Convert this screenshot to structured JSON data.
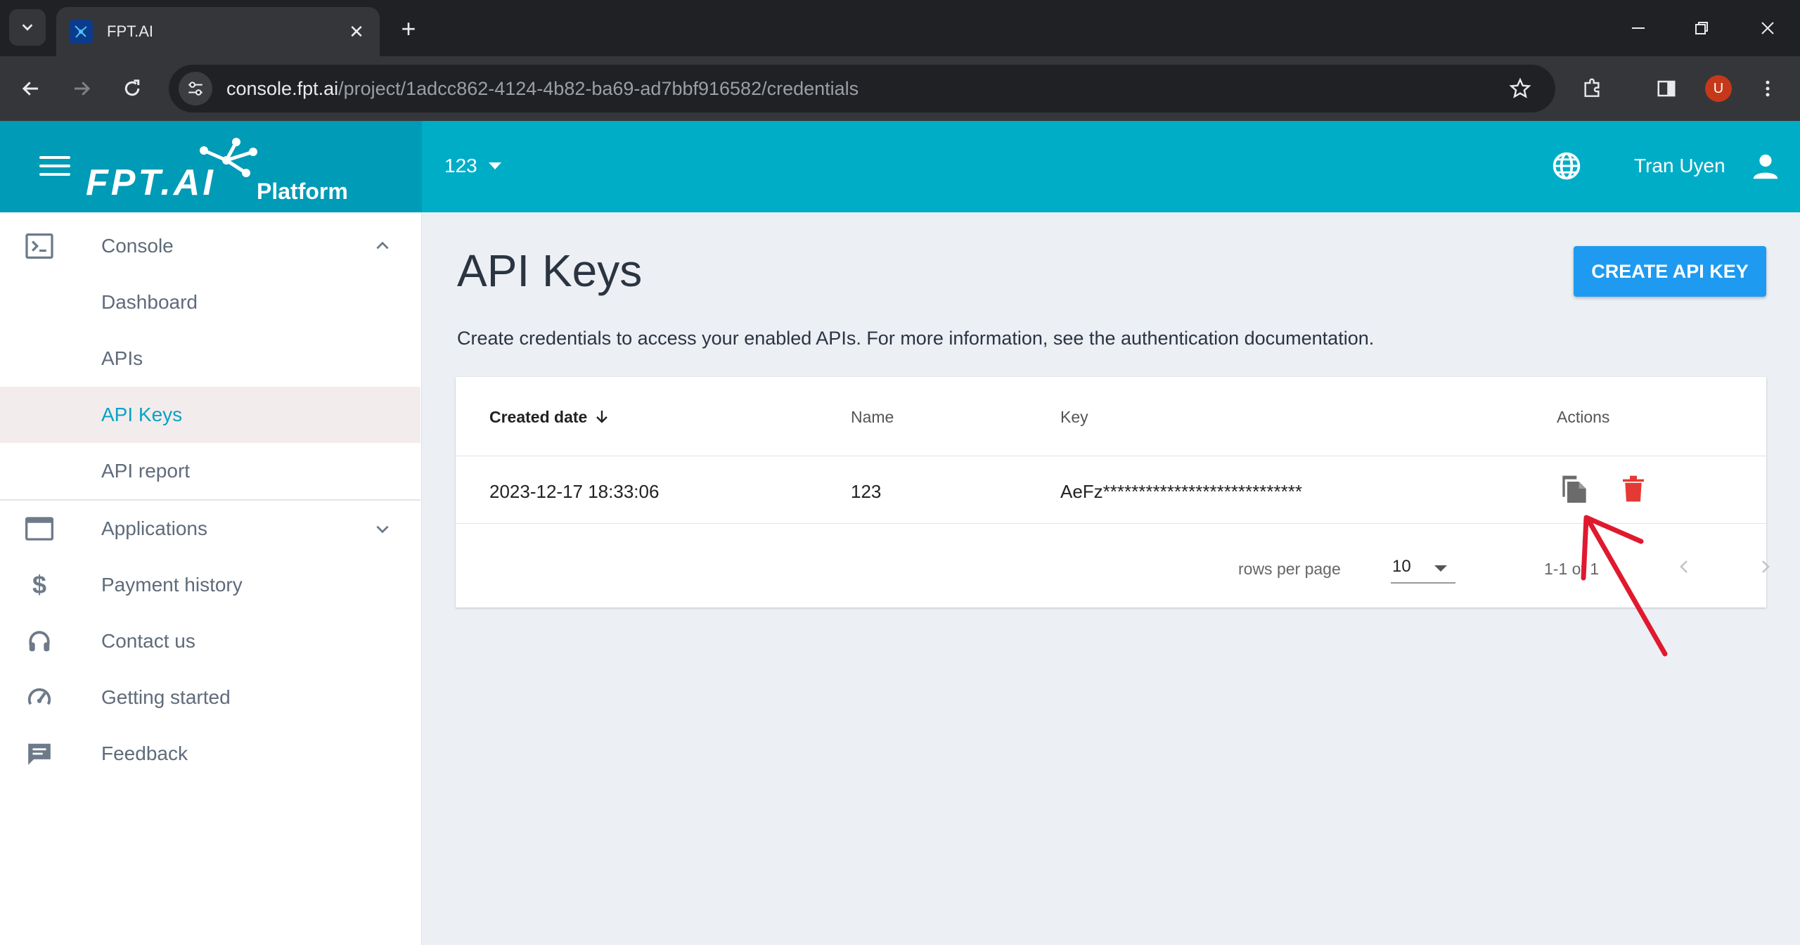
{
  "browser": {
    "tab_title": "FPT.AI",
    "url_host": "console.fpt.ai",
    "url_path": "/project/1adcc862-4124-4b82-ba69-ad7bbf916582/credentials",
    "profile_initial": "U"
  },
  "header": {
    "logo_text": "FPT.AI",
    "logo_suffix": "Platform",
    "project_name": "123",
    "user_name": "Tran Uyen"
  },
  "sidebar": {
    "console": "Console",
    "dashboard": "Dashboard",
    "apis": "APIs",
    "api_keys": "API Keys",
    "api_report": "API report",
    "applications": "Applications",
    "payment_history": "Payment history",
    "contact_us": "Contact us",
    "getting_started": "Getting started",
    "feedback": "Feedback"
  },
  "main": {
    "title": "API Keys",
    "create_button": "CREATE API KEY",
    "description": "Create credentials to access your enabled APIs. For more information, see the authentication documentation."
  },
  "table": {
    "headers": {
      "created_date": "Created date",
      "name": "Name",
      "key": "Key",
      "actions": "Actions"
    },
    "rows": [
      {
        "created_date": "2023-12-17 18:33:06",
        "name": "123",
        "key": "AeFz****************************"
      }
    ],
    "rows_per_page_label": "rows per page",
    "rows_per_page_value": "10",
    "range_text": "1-1 of 1"
  },
  "colors": {
    "header": "#00adc7",
    "accent": "#0aa3c2",
    "primary_button": "#1e9bf0",
    "delete": "#e53935",
    "annotation_arrow": "#e0192e"
  }
}
